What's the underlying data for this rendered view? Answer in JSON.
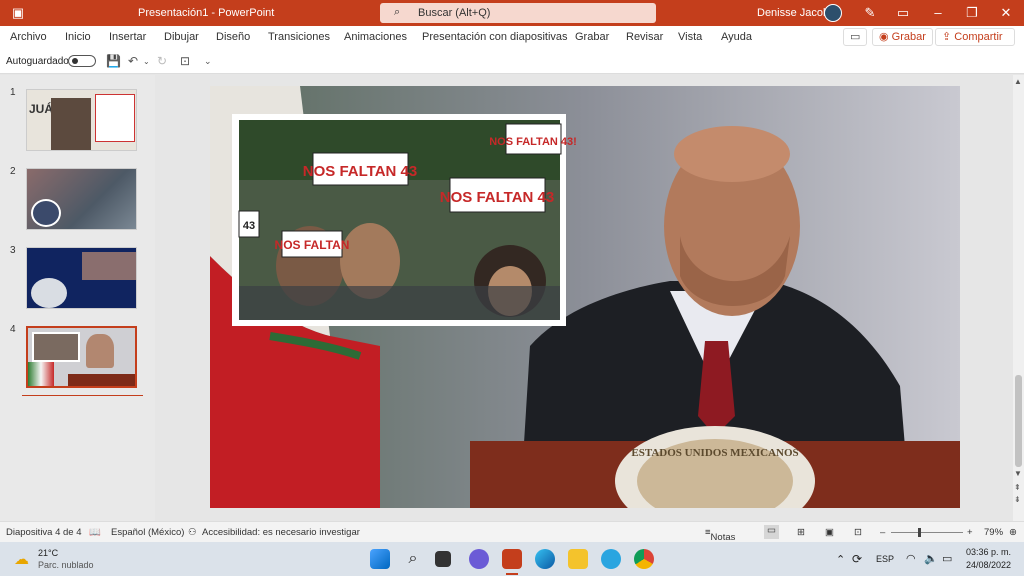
{
  "titlebar": {
    "title": "Presentación1  -  PowerPoint",
    "search_placeholder": "Buscar (Alt+Q)",
    "user": "Denisse Jacobo"
  },
  "ribbon": {
    "tabs": [
      "Archivo",
      "Inicio",
      "Insertar",
      "Dibujar",
      "Diseño",
      "Transiciones",
      "Animaciones",
      "Presentación con diapositivas",
      "Grabar",
      "Revisar",
      "Vista",
      "Ayuda"
    ],
    "record_label": "Grabar",
    "share_label": "Compartir"
  },
  "qat": {
    "autosave_label": "Autoguardado"
  },
  "thumbnails": [
    {
      "number": "1",
      "title_text": "JUÁRE"
    },
    {
      "number": "2"
    },
    {
      "number": "3"
    },
    {
      "number": "4"
    }
  ],
  "slide": {
    "signs": [
      "NOS FALTAN 43",
      "NOS FALTAN 43",
      "NOS FALTAN 43!",
      "NOS FALTAN",
      "43"
    ],
    "seal_text": "ESTADOS UNIDOS MEXICANOS"
  },
  "statusbar": {
    "slide_info": "Diapositiva 4 de 4",
    "language": "Español (México)",
    "accessibility": "Accesibilidad: es necesario investigar",
    "notes": "Notas",
    "zoom": "79%"
  },
  "taskbar": {
    "weather_temp": "21°C",
    "weather_desc": "Parc. nublado",
    "lang": "ESP",
    "time": "03:36 p. m.",
    "date": "24/08/2022"
  }
}
